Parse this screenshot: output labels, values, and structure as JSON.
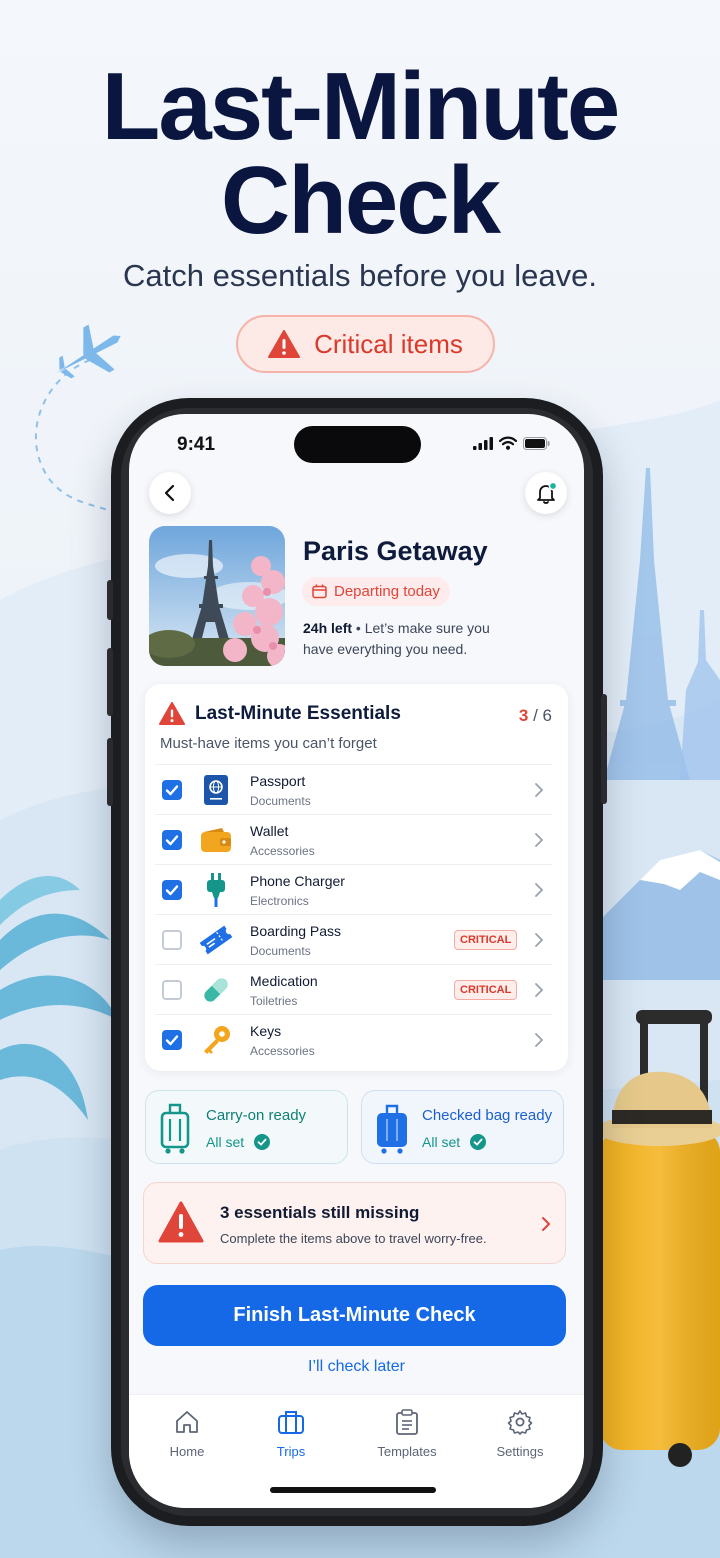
{
  "promo": {
    "headline_line1": "Last-Minute",
    "headline_line2": "Check",
    "subhead": "Catch essentials before you leave.",
    "pill_label": "Critical items"
  },
  "status_bar": {
    "time": "9:41"
  },
  "trip": {
    "title": "Paris Getaway",
    "badge": "Departing today",
    "time_left": "24h left",
    "note": " • Let’s make sure you have everything you need."
  },
  "essentials": {
    "title": "Last-Minute Essentials",
    "subtitle": "Must-have items you can’t forget",
    "count_done": "3",
    "count_sep": " / ",
    "count_total": "6",
    "critical_label": "CRITICAL",
    "items": [
      {
        "name": "Passport",
        "category": "Documents",
        "checked": true,
        "critical": false,
        "icon": "passport-icon"
      },
      {
        "name": "Wallet",
        "category": "Accessories",
        "checked": true,
        "critical": false,
        "icon": "wallet-icon"
      },
      {
        "name": "Phone Charger",
        "category": "Electronics",
        "checked": true,
        "critical": false,
        "icon": "charger-plug-icon"
      },
      {
        "name": "Boarding Pass",
        "category": "Documents",
        "checked": false,
        "critical": true,
        "icon": "ticket-icon"
      },
      {
        "name": "Medication",
        "category": "Toiletries",
        "checked": false,
        "critical": true,
        "icon": "pill-icon"
      },
      {
        "name": "Keys",
        "category": "Accessories",
        "checked": true,
        "critical": false,
        "icon": "key-icon"
      }
    ]
  },
  "bags": {
    "carry_on": {
      "title": "Carry-on ready",
      "status": "All set",
      "color": "#14968a"
    },
    "checked": {
      "title": "Checked bag ready",
      "status": "All set",
      "color": "#1f6fe5"
    }
  },
  "missing": {
    "title": "3 essentials still missing",
    "subtitle": "Complete the items above to travel worry-free."
  },
  "cta": {
    "label": "Finish Last-Minute Check",
    "secondary": "I’ll check later"
  },
  "tabs": [
    {
      "label": "Home",
      "icon": "home-icon",
      "active": false
    },
    {
      "label": "Trips",
      "icon": "suitcase-icon",
      "active": true
    },
    {
      "label": "Templates",
      "icon": "clipboard-icon",
      "active": false
    },
    {
      "label": "Settings",
      "icon": "gear-icon",
      "active": false
    }
  ],
  "colors": {
    "accent": "#1669e6",
    "critical": "#e0453a",
    "check": "#1f6fe5",
    "teal": "#14968a"
  }
}
